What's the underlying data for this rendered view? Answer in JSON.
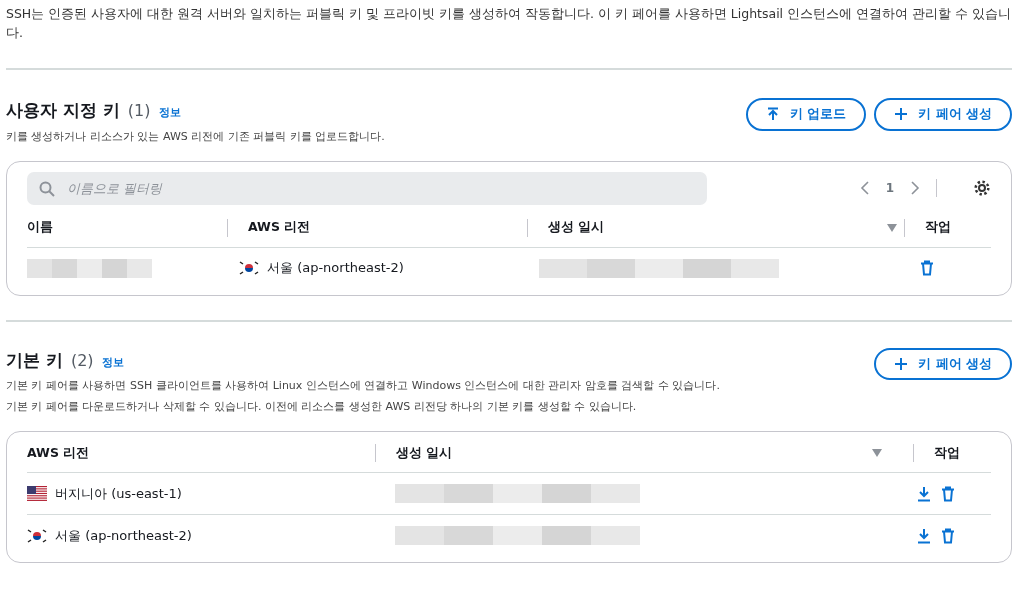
{
  "intro": "SSH는 인증된 사용자에 대한 원격 서버와 일치하는 퍼블릭 키 및 프라이빗 키를 생성하여 작동합니다. 이 키 페어를 사용하면 Lightsail 인스턴스에 연결하여 관리할 수 있습니다.",
  "custom_keys": {
    "title": "사용자 지정 키",
    "count": "(1)",
    "info": "정보",
    "description": "키를 생성하거나 리소스가 있는 AWS 리전에 기존 퍼블릭 키를 업로드합니다.",
    "buttons": [
      {
        "kind": "upload",
        "label": "키 업로드"
      },
      {
        "kind": "add",
        "label": "키 페어 생성"
      }
    ],
    "filter": {
      "placeholder": "이름으로 필터링"
    },
    "page": "1",
    "columns": [
      "이름",
      "AWS 리전",
      "생성 일시",
      "작업"
    ],
    "rows": [
      {
        "kind": "kr",
        "region": "서울 (ap-northeast-2)"
      }
    ]
  },
  "default_keys": {
    "title": "기본 키",
    "count": "(2)",
    "info": "정보",
    "description": [
      "기본 키 페어를 사용하면 SSH 클라이언트를 사용하여 Linux 인스턴스에 연결하고 Windows 인스턴스에 대한 관리자 암호를 검색할 수 있습니다.",
      "기본 키 페어를 다운로드하거나 삭제할 수 있습니다. 이전에 리소스를 생성한 AWS 리전당 하나의 기본 키를 생성할 수 있습니다."
    ],
    "buttons": [
      {
        "kind": "add",
        "label": "키 페어 생성"
      }
    ],
    "columns": [
      "AWS 리전",
      "생성 일시",
      "작업"
    ],
    "rows": [
      {
        "kind": "us",
        "region": "버지니아 (us-east-1)"
      },
      {
        "kind": "kr",
        "region": "서울 (ap-northeast-2)"
      }
    ]
  }
}
